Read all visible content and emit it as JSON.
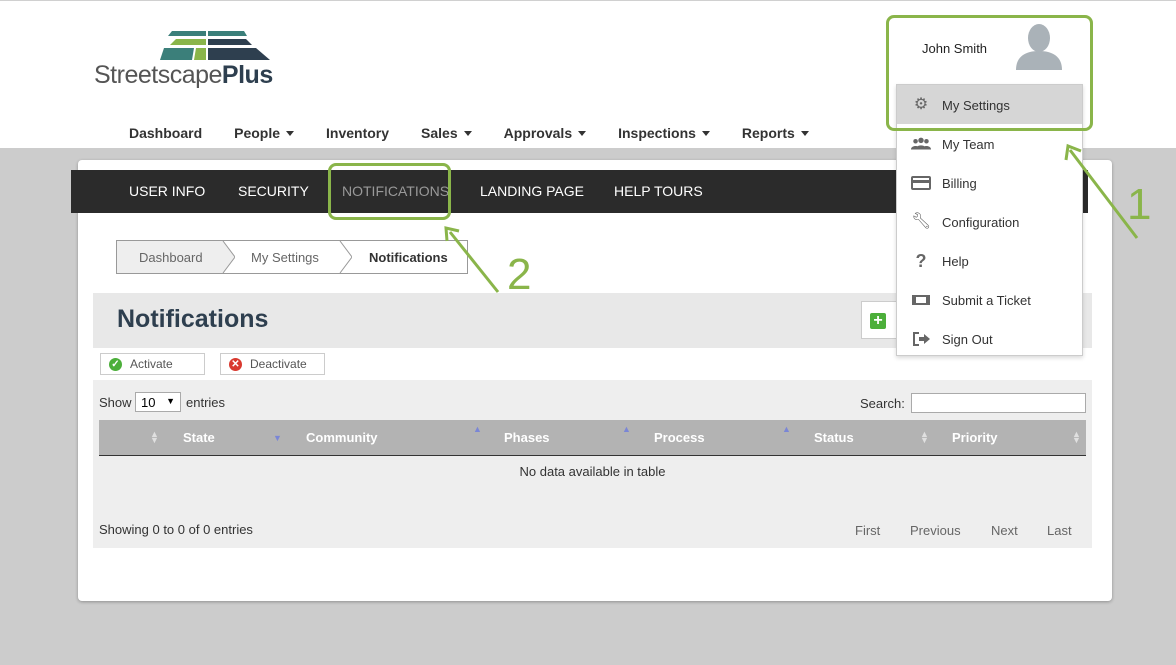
{
  "brand": {
    "name_part1": "Streetscape",
    "name_part2": "Plus"
  },
  "topnav": [
    {
      "label": "Dashboard",
      "dropdown": false
    },
    {
      "label": "People",
      "dropdown": true
    },
    {
      "label": "Inventory",
      "dropdown": false
    },
    {
      "label": "Sales",
      "dropdown": true
    },
    {
      "label": "Approvals",
      "dropdown": true
    },
    {
      "label": "Inspections",
      "dropdown": true
    },
    {
      "label": "Reports",
      "dropdown": true
    }
  ],
  "tabs": [
    {
      "label": "USER INFO"
    },
    {
      "label": "SECURITY"
    },
    {
      "label": "NOTIFICATIONS",
      "active": true
    },
    {
      "label": "LANDING PAGE"
    },
    {
      "label": "HELP TOURS"
    }
  ],
  "breadcrumb": [
    "Dashboard",
    "My Settings",
    "Notifications"
  ],
  "page": {
    "title": "Notifications"
  },
  "actions": {
    "activate": "Activate",
    "deactivate": "Deactivate"
  },
  "table": {
    "show_label": "Show",
    "page_size": "10",
    "entries_label": "entries",
    "search_label": "Search:",
    "columns": [
      "State",
      "Community",
      "Phases",
      "Process",
      "Status",
      "Priority"
    ],
    "empty_message": "No data available in table",
    "info": "Showing 0 to 0 of 0 entries",
    "pager": [
      "First",
      "Previous",
      "Next",
      "Last"
    ]
  },
  "user": {
    "name": "John Smith"
  },
  "user_menu": [
    {
      "label": "My Settings",
      "icon": "gear-icon",
      "active": true
    },
    {
      "label": "My Team",
      "icon": "team-icon"
    },
    {
      "label": "Billing",
      "icon": "credit-card-icon"
    },
    {
      "label": "Configuration",
      "icon": "wrench-icon"
    },
    {
      "label": "Help",
      "icon": "question-icon"
    },
    {
      "label": "Submit a Ticket",
      "icon": "ticket-icon"
    },
    {
      "label": "Sign Out",
      "icon": "sign-out-icon"
    }
  ],
  "callouts": [
    "1",
    "2"
  ],
  "colors": {
    "highlight": "#8ab54a",
    "tabbar": "#2b2b2b",
    "title": "#2e3f4f"
  }
}
